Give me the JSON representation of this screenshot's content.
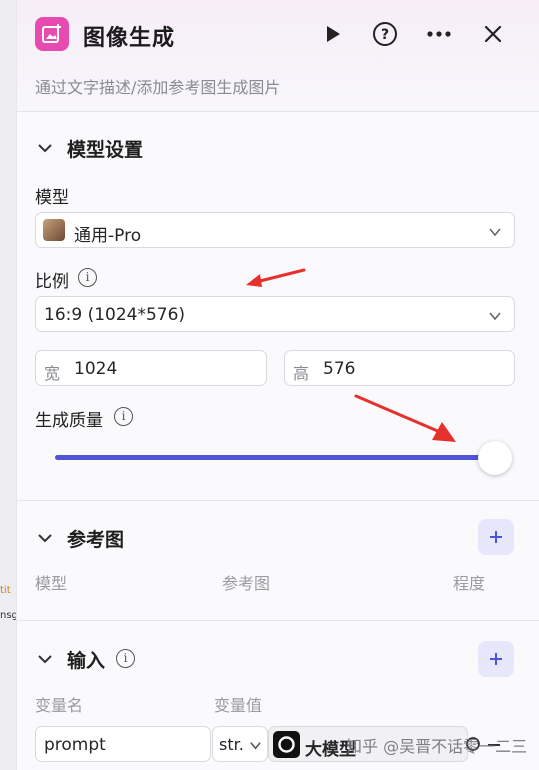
{
  "left_fragments": [
    "tit",
    "nsg"
  ],
  "header": {
    "title": "图像生成",
    "subtitle": "通过文字描述/添加参考图生成图片"
  },
  "model_settings": {
    "title": "模型设置",
    "model_label": "模型",
    "model_value": "通用-Pro",
    "ratio_label": "比例",
    "ratio_value": "16:9 (1024*576)",
    "width_label": "宽",
    "width_value": "1024",
    "height_label": "高",
    "height_value": "576",
    "quality_label": "生成质量",
    "quality_level": 1.0
  },
  "reference": {
    "title": "参考图",
    "columns": [
      "模型",
      "参考图",
      "程度"
    ]
  },
  "input": {
    "title": "输入",
    "col_name": "变量名",
    "col_value": "变量值",
    "var_name": "prompt",
    "var_type": "str.",
    "var_ref": "大模型"
  },
  "watermark": "知乎 @吴晋不话零一二三",
  "colors": {
    "accent": "#4f55d6",
    "app_icon": "#e84bb0",
    "arrow": "#e5302d"
  }
}
